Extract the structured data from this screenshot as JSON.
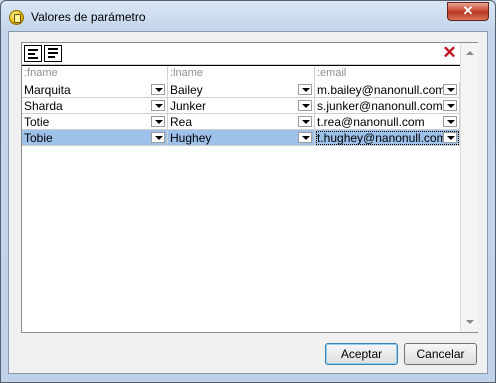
{
  "window": {
    "title": "Valores de parámetro",
    "close_glyph": "✕"
  },
  "toolbar": {
    "buttons": [
      "insert-row-icon",
      "append-row-icon"
    ],
    "delete_icon": "delete-x-icon",
    "delete_glyph": "✕"
  },
  "table": {
    "columns": [
      ":fname",
      ":lname",
      ":email"
    ],
    "rows": [
      [
        "Marquita",
        "Bailey",
        "m.bailey@nanonull.com"
      ],
      [
        "Sharda",
        "Junker",
        "s.junker@nanonull.com"
      ],
      [
        "Totie",
        "Rea",
        "t.rea@nanonull.com"
      ],
      [
        "Tobie",
        "Hughey",
        "t.hughey@nanonull.com"
      ]
    ],
    "selected_row": 3
  },
  "buttons": {
    "ok": "Aceptar",
    "cancel": "Cancelar"
  },
  "colors": {
    "selection": "#9ec1ea",
    "delete": "#c1121f",
    "close": "#c7452c"
  }
}
